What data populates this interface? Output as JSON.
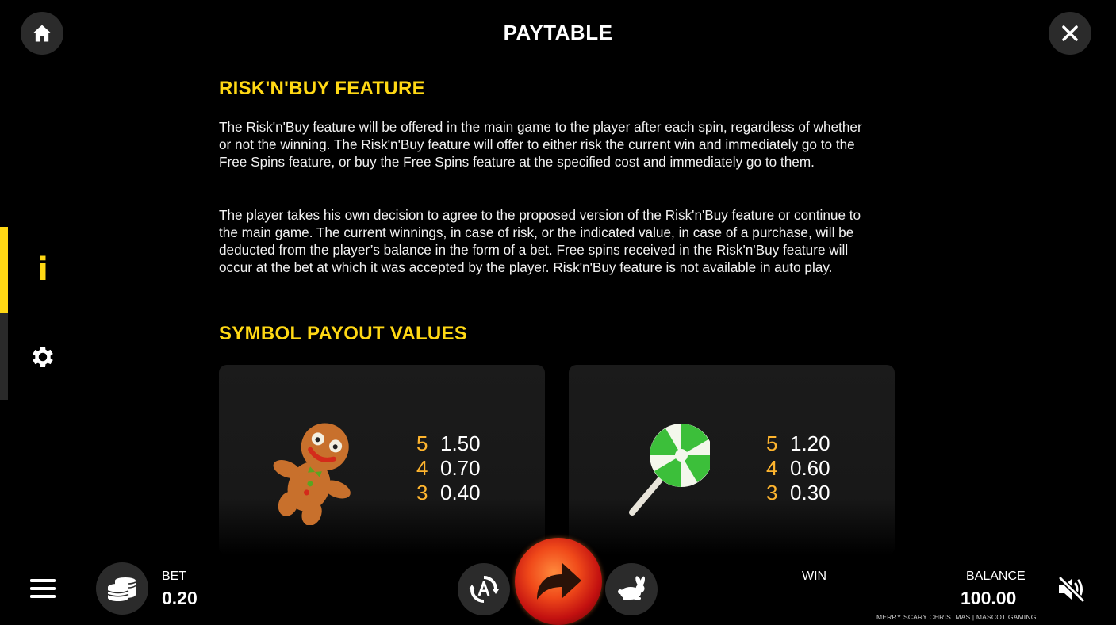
{
  "header": {
    "title": "PAYTABLE",
    "home_icon": "home-icon",
    "close_icon": "close-icon"
  },
  "side_nav": {
    "tabs": [
      {
        "id": "info",
        "icon": "info-icon",
        "active": true
      },
      {
        "id": "settings",
        "icon": "gear-icon",
        "active": false
      }
    ],
    "accent_color": "#ffd814"
  },
  "content": {
    "risk_section": {
      "heading": "RISK'N'BUY FEATURE",
      "paragraph_1": "The Risk'n'Buy feature will be offered in the main game to the player after each spin, regardless of whether or not the winning. The Risk'n'Buy feature will offer to either risk the current win and immediately go to the Free Spins feature, or buy the Free Spins feature at the specified cost and immediately go to them.",
      "paragraph_2": "The player takes his own decision to agree to the proposed version of the Risk'n'Buy feature or continue to the main game. The current winnings, in case of risk, or the indicated value, in case of a purchase, will be deducted from the player’s balance in the form of a bet. Free spins received in the Risk'n'Buy feature will occur at the bet at which it was accepted by the player. Risk'n'Buy feature is not available in auto play."
    },
    "payout_section": {
      "heading": "SYMBOL PAYOUT VALUES",
      "cards": [
        {
          "symbol": "gingerbread-man-icon",
          "pays": [
            {
              "count": "5",
              "value": "1.50"
            },
            {
              "count": "4",
              "value": "0.70"
            },
            {
              "count": "3",
              "value": "0.40"
            }
          ]
        },
        {
          "symbol": "lollipop-icon",
          "pays": [
            {
              "count": "5",
              "value": "1.20"
            },
            {
              "count": "4",
              "value": "0.60"
            },
            {
              "count": "3",
              "value": "0.30"
            }
          ]
        }
      ]
    }
  },
  "bottom_bar": {
    "menu_icon": "menu-icon",
    "bet_icon": "coins-icon",
    "bet_label": "BET",
    "bet_value": "0.20",
    "autoplay_icon": "autoplay-icon",
    "spin_icon": "spin-arrow-icon",
    "turbo_icon": "rabbit-icon",
    "win_label": "WIN",
    "balance_label": "BALANCE",
    "balance_value": "100.00",
    "mute_icon": "sound-muted-icon",
    "footer": "MERRY SCARY CHRISTMAS | MASCOT GAMING"
  },
  "colors": {
    "heading": "#ffd814",
    "pay_count": "#ffb52e",
    "spin_button": "#e23a12"
  }
}
